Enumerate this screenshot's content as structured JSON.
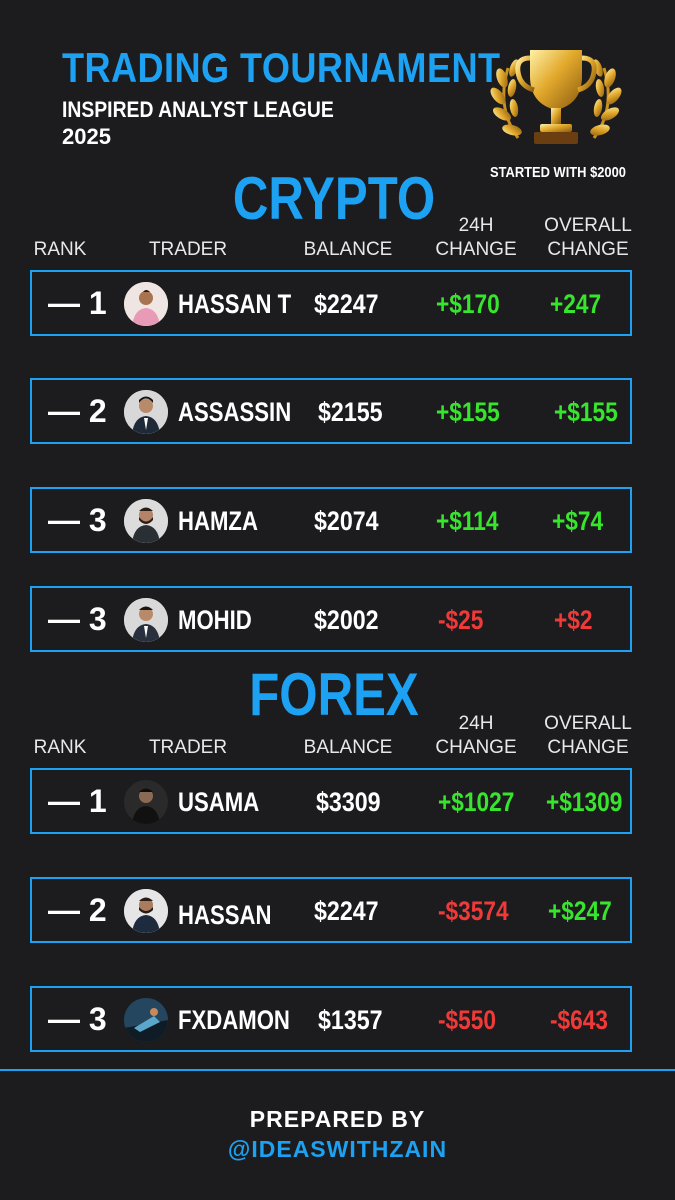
{
  "header": {
    "title": "TRADING TOURNAMENT",
    "subtitle": "INSPIRED ANALYST LEAGUE",
    "year": "2025",
    "started_note": "STARTED WITH $2000",
    "trophy_icon": "trophy-icon"
  },
  "columns": {
    "rank": "RANK",
    "trader": "TRADER",
    "balance": "BALANCE",
    "change24_line1": "24H",
    "change24_line2": "CHANGE",
    "overall_line1": "OVERALL",
    "overall_line2": "CHANGE"
  },
  "crypto": {
    "title": "CRYPTO",
    "rows": [
      {
        "rank": "— 1",
        "trader": "HASSAN T",
        "balance": "$2247",
        "change_24h": "+$170",
        "overall": "+247"
      },
      {
        "rank": "— 2",
        "trader": "ASSASSIN",
        "balance": "$2155",
        "change_24h": "+$155",
        "overall": "+$155"
      },
      {
        "rank": "— 3",
        "trader": "HAMZA",
        "balance": "$2074",
        "change_24h": "+$114",
        "overall": "+$74"
      },
      {
        "rank": "— 3",
        "trader": "MOHID",
        "balance": "$2002",
        "change_24h": "-$25",
        "overall": "+$2"
      }
    ]
  },
  "forex": {
    "title": "FOREX",
    "rows": [
      {
        "rank": "— 1",
        "trader": "USAMA",
        "balance": "$3309",
        "change_24h": "+$1027",
        "overall": "+$1309"
      },
      {
        "rank": "— 2",
        "trader": "HASSAN",
        "balance": "$2247",
        "change_24h": "-$3574",
        "overall": "+$247"
      },
      {
        "rank": "— 3",
        "trader": "FXDAMON",
        "balance": "$1357",
        "change_24h": "-$550",
        "overall": "-$643"
      }
    ]
  },
  "footer": {
    "prepared_by": "PREPARED BY",
    "handle": "@IDEASWITHZAIN"
  },
  "colors": {
    "accent": "#1da1f2",
    "positive": "#37e52c",
    "negative": "#f03a3a",
    "background": "#1c1c1e"
  }
}
